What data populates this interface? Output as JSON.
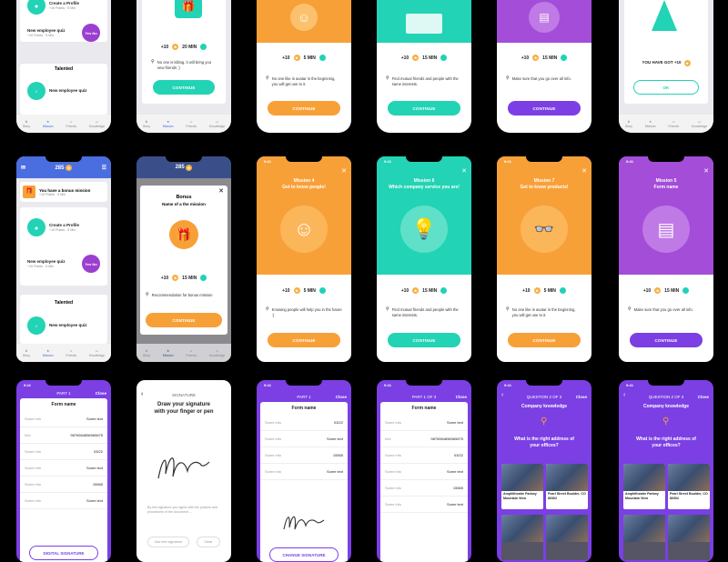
{
  "common": {
    "time": "9:41",
    "plus": "+10",
    "coin": "★"
  },
  "row1": {
    "p1": {
      "items": [
        {
          "title": "Create a Profile",
          "sub": "+10 Points  ·  5 Min"
        },
        {
          "title": "New employee quiz",
          "sub": "+10 Points  ·  5 Min",
          "badge": "Yes No"
        }
      ],
      "talented": "Talented",
      "quiz": "New employee quiz",
      "tabs": [
        "Story",
        "Mission",
        "Friends",
        "Knowledge"
      ]
    },
    "p2": {
      "time": "20 MIN",
      "desc": "No one is kilting, it will bring you new friends :)",
      "btn": "CONTINUE",
      "tabs": [
        "Story",
        "Mission",
        "Friends",
        "Knowledge"
      ]
    },
    "p3": {
      "time": "5 MIN",
      "desc": "No one like is avatar in the beginning, you will get use to it.",
      "btn": "CONTINUE"
    },
    "p4": {
      "time": "15 MIN",
      "desc": "Find mutual friends and people with the same interests.",
      "btn": "CONTINUE"
    },
    "p5": {
      "time": "15 MIN",
      "desc": "Make sure  that you go over all info.",
      "btn": "CONTINUE"
    },
    "p6": {
      "msg": "YOU HAVE GOT +10",
      "btn": "OK",
      "tabs": [
        "Story",
        "Mission",
        "Friends",
        "Knowledge"
      ]
    }
  },
  "row2": {
    "p1": {
      "points": "285",
      "bonus": "You have a bonus mission",
      "bonus_sub": "+10 Points  ·  5 Min",
      "items": [
        {
          "title": "Create a Profile",
          "sub": "+10 Points  ·  5 Min"
        },
        {
          "title": "New employee quiz",
          "sub": "+10 Points  ·  5 Min",
          "badge": "Yes No"
        }
      ],
      "talented": "Talented",
      "quiz": "New employee quiz",
      "tabs": [
        "Story",
        "Mission",
        "Friends",
        "Knowledge"
      ]
    },
    "p2": {
      "points": "285",
      "title": "Bonus",
      "sub": "Name of a the mission",
      "time": "15 MIN",
      "desc": "Recommendation for bonus mission",
      "btn": "CONTINUE",
      "tabs": [
        "Story",
        "Mission",
        "Friends",
        "Knowledge"
      ]
    },
    "p3": {
      "title": "Mission 4",
      "sub": "Get to know people!",
      "time": "5 MIN",
      "desc": "Knowing people will help you in the future :)",
      "btn": "CONTINUE"
    },
    "p4": {
      "title": "Mission 6",
      "sub": "Which company service you are!",
      "time": "15 MIN",
      "desc": "Find mutual friends and people with the same interests.",
      "btn": "CONTINUE"
    },
    "p5": {
      "title": "Mission 7",
      "sub": "Get to know products!",
      "time": "5 MIN",
      "desc": "No one like is avatar in the beginning, you will get use to it.",
      "btn": "CONTINUE"
    },
    "p6": {
      "title": "Mission 5",
      "sub": "Form name",
      "time": "15 MIN",
      "desc": "Make sure  that you go over all info.",
      "btn": "CONTINUE"
    }
  },
  "row3": {
    "p1": {
      "hdr": "PART 1",
      "close": "Close",
      "form": "Form name",
      "rows": [
        [
          "Some info",
          "Some text"
        ],
        [
          "Info",
          "9876984856965675"
        ],
        [
          "Some info",
          "03/22"
        ],
        [
          "Some info",
          "Some text"
        ],
        [
          "Some info",
          "15565"
        ],
        [
          "Some info",
          "Some text"
        ]
      ],
      "btn": "DIGITAL SIGNATURE"
    },
    "p2": {
      "hdr": "SIGNATURE",
      "title": "Draw your signature with your finger or pen",
      "consent": "By this signature you agree with the policies and procedures of the document ...",
      "b1": "Use text signature",
      "b2": "Clear"
    },
    "p3": {
      "hdr": "PART 1",
      "close": "Close",
      "form": "Form name",
      "rows": [
        [
          "Some info",
          "03/22"
        ],
        [
          "Some info",
          "Some text"
        ],
        [
          "Some info",
          "15565"
        ],
        [
          "Some info",
          "Some text"
        ]
      ],
      "btn": "CHANGE SIGNATURE"
    },
    "p4": {
      "hdr": "PART 1 OF 3",
      "close": "Close",
      "form": "Form name",
      "rows": [
        [
          "Some info",
          "Some text"
        ],
        [
          "Info",
          "9876984856965675"
        ],
        [
          "Some info",
          "03/22"
        ],
        [
          "Some info",
          "Some text"
        ],
        [
          "Some info",
          "15565"
        ],
        [
          "Some info",
          "Some text"
        ]
      ]
    },
    "p5": {
      "hdr": "QUESTION 2 OF 3",
      "close": "Close",
      "sub": "Company knowledge",
      "q": "What is the right address of your offices?",
      "a1": "Amphitheatre Parkwy Mountain View",
      "a2": "Pearl Street Boulder, CO 80302"
    },
    "p6": {
      "hdr": "QUESTION 2 OF 3",
      "close": "Close",
      "sub": "Company knowledge",
      "q": "What is the right address of your offices?",
      "a1": "Amphitheatre Parkwy Mountain View",
      "a2": "Pearl Street Boulder, CO 80302"
    }
  }
}
